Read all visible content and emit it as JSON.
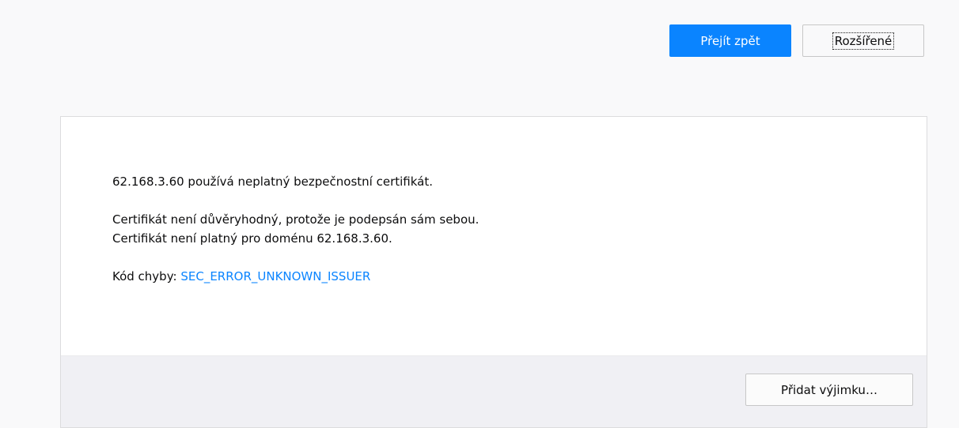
{
  "header": {
    "go_back_label": "Přejít zpět",
    "advanced_label": "Rozšířené"
  },
  "panel": {
    "line1": "62.168.3.60 používá neplatný bezpečnostní certifikát.",
    "line2": "Certifikát není důvěryhodný, protože je podepsán sám sebou.",
    "line3": "Certifikát není platný pro doménu 62.168.3.60.",
    "error_code_prefix": "Kód chyby:",
    "error_code": "SEC_ERROR_UNKNOWN_ISSUER",
    "add_exception_label": "Přidat výjimku…"
  },
  "colors": {
    "primary": "#0a84ff",
    "link": "#0a84ff",
    "page_background": "#f9f9fa",
    "panel_background": "#ffffff",
    "footer_background": "#f0f0f4"
  }
}
